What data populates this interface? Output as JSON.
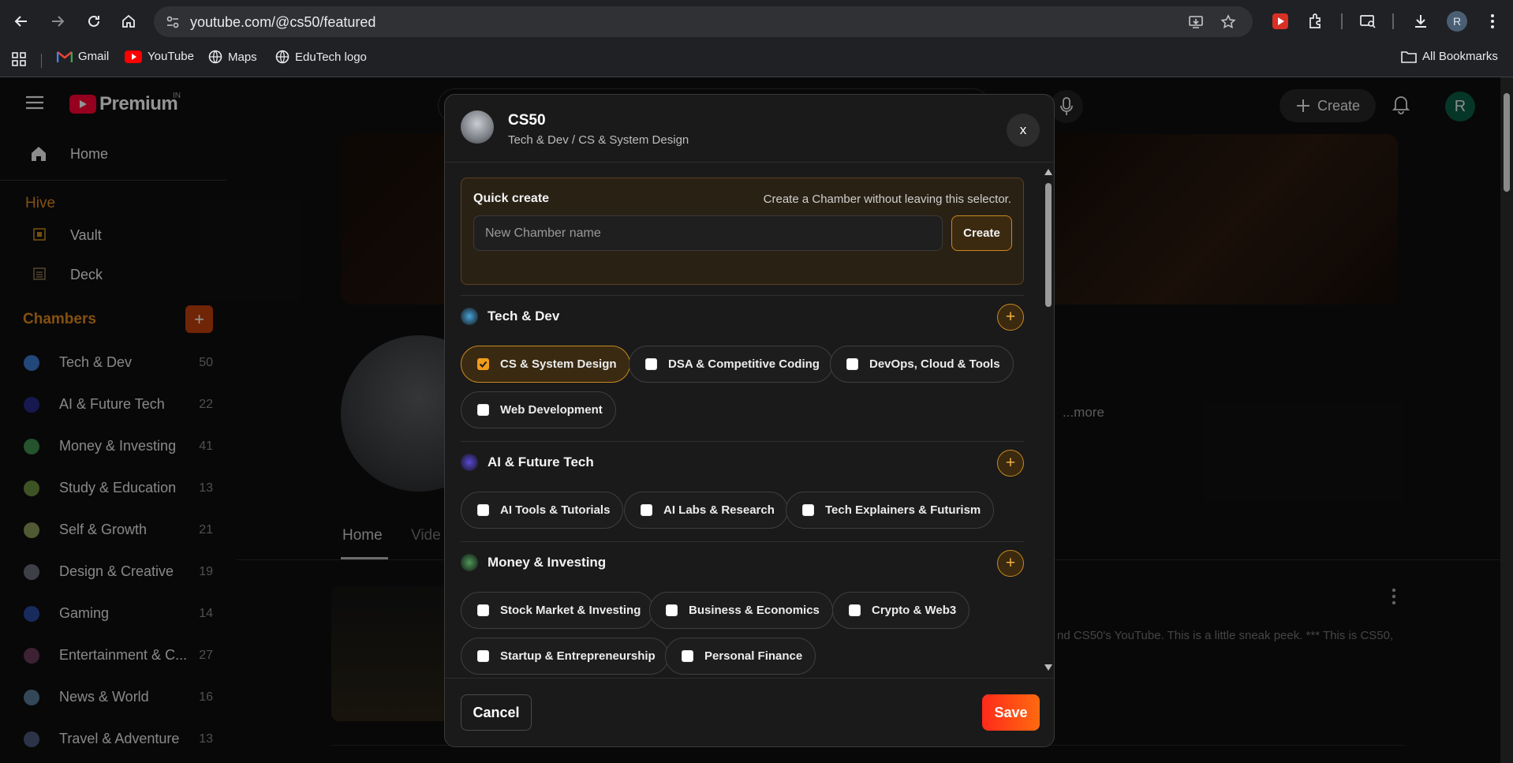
{
  "browser": {
    "url": "youtube.com/@cs50/featured",
    "profile_initial": "R",
    "bookmarks": [
      {
        "label": "Gmail"
      },
      {
        "label": "YouTube"
      },
      {
        "label": "Maps"
      },
      {
        "label": "EduTech logo"
      }
    ],
    "all_bookmarks": "All Bookmarks"
  },
  "youtube": {
    "logo_text": "Premium",
    "region": "IN",
    "create_label": "Create",
    "avatar_initial": "R",
    "more_label": "...more",
    "tabs": [
      {
        "label": "Home"
      },
      {
        "label": "Vide"
      }
    ],
    "video_description": "nd CS50's YouTube. This is a little sneak peek. *** This is CS50,"
  },
  "sidebar": {
    "home_label": "Home",
    "hive_title": "Hive",
    "hive_items": [
      {
        "label": "Vault"
      },
      {
        "label": "Deck"
      }
    ],
    "chambers_title": "Chambers",
    "chambers_add": "+",
    "chambers": [
      {
        "name": "Tech & Dev",
        "count": "50",
        "color": "#3a7bd5"
      },
      {
        "name": "AI & Future Tech",
        "count": "22",
        "color": "#2a2a8a"
      },
      {
        "name": "Money & Investing",
        "count": "41",
        "color": "#3f8f4f"
      },
      {
        "name": "Study & Education",
        "count": "13",
        "color": "#6b8f3f"
      },
      {
        "name": "Self & Growth",
        "count": "21",
        "color": "#8a9a5a"
      },
      {
        "name": "Design & Creative",
        "count": "19",
        "color": "#6a6f7a"
      },
      {
        "name": "Gaming",
        "count": "14",
        "color": "#2a4aa0"
      },
      {
        "name": "Entertainment & C...",
        "count": "27",
        "color": "#6a3a5a"
      },
      {
        "name": "News & World",
        "count": "16",
        "color": "#5a7a9a"
      },
      {
        "name": "Travel & Adventure",
        "count": "13",
        "color": "#4a5a7a"
      }
    ]
  },
  "modal": {
    "title": "CS50",
    "subtitle": "Tech & Dev / CS & System Design",
    "close_label": "x",
    "quick_create": {
      "title": "Quick create",
      "hint": "Create a Chamber without leaving this selector.",
      "placeholder": "New Chamber name",
      "button": "Create"
    },
    "groups": [
      {
        "title": "Tech & Dev",
        "icon_color": "#4aa3d8",
        "add": "+",
        "items": [
          {
            "label": "CS & System Design",
            "checked": true
          },
          {
            "label": "DSA & Competitive Coding",
            "checked": false
          },
          {
            "label": "DevOps, Cloud & Tools",
            "checked": false
          },
          {
            "label": "Web Development",
            "checked": false
          }
        ]
      },
      {
        "title": "AI & Future Tech",
        "icon_color": "#5a4ad8",
        "add": "+",
        "items": [
          {
            "label": "AI Tools & Tutorials",
            "checked": false
          },
          {
            "label": "AI Labs & Research",
            "checked": false
          },
          {
            "label": "Tech Explainers & Futurism",
            "checked": false
          }
        ]
      },
      {
        "title": "Money & Investing",
        "icon_color": "#4f9a5a",
        "add": "+",
        "items": [
          {
            "label": "Stock Market & Investing",
            "checked": false
          },
          {
            "label": "Business & Economics",
            "checked": false
          },
          {
            "label": "Crypto & Web3",
            "checked": false
          },
          {
            "label": "Startup & Entrepreneurship",
            "checked": false
          },
          {
            "label": "Personal Finance",
            "checked": false
          }
        ]
      }
    ],
    "cancel_label": "Cancel",
    "save_label": "Save"
  }
}
